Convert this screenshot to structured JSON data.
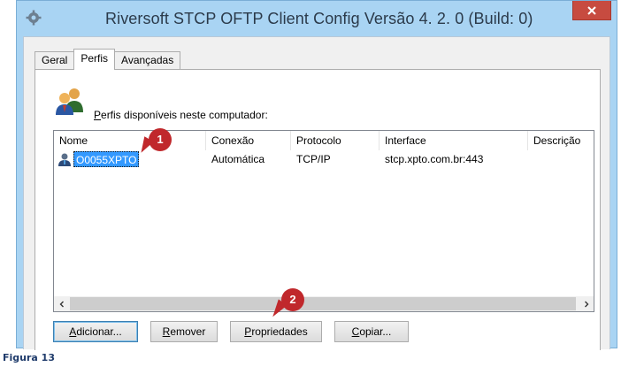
{
  "window": {
    "title": "Riversoft  STCP OFTP Client Config Versão 4. 2. 0 (Build: 0)"
  },
  "tabs": [
    {
      "label": "Geral"
    },
    {
      "label": "Perfis"
    },
    {
      "label": "Avançadas"
    }
  ],
  "profiles": {
    "header_label": "Perfis disponíveis neste computador:",
    "columns": [
      "Nome",
      "Conexão",
      "Protocolo",
      "Interface",
      "Descrição"
    ],
    "rows": [
      {
        "name": "O0055XPTO",
        "connection": "Automática",
        "protocol": "TCP/IP",
        "interface": "stcp.xpto.com.br:443",
        "description": ""
      }
    ]
  },
  "buttons": {
    "add": "Adicionar...",
    "remove": "Remover",
    "properties": "Propriedades",
    "copy": "Copiar..."
  },
  "callouts": [
    "1",
    "2"
  ],
  "caption": "Figura 13",
  "colors": {
    "titlebar": "#a9d4f3",
    "close": "#c74b40",
    "selection": "#3399ff",
    "callout": "#c0282c"
  }
}
